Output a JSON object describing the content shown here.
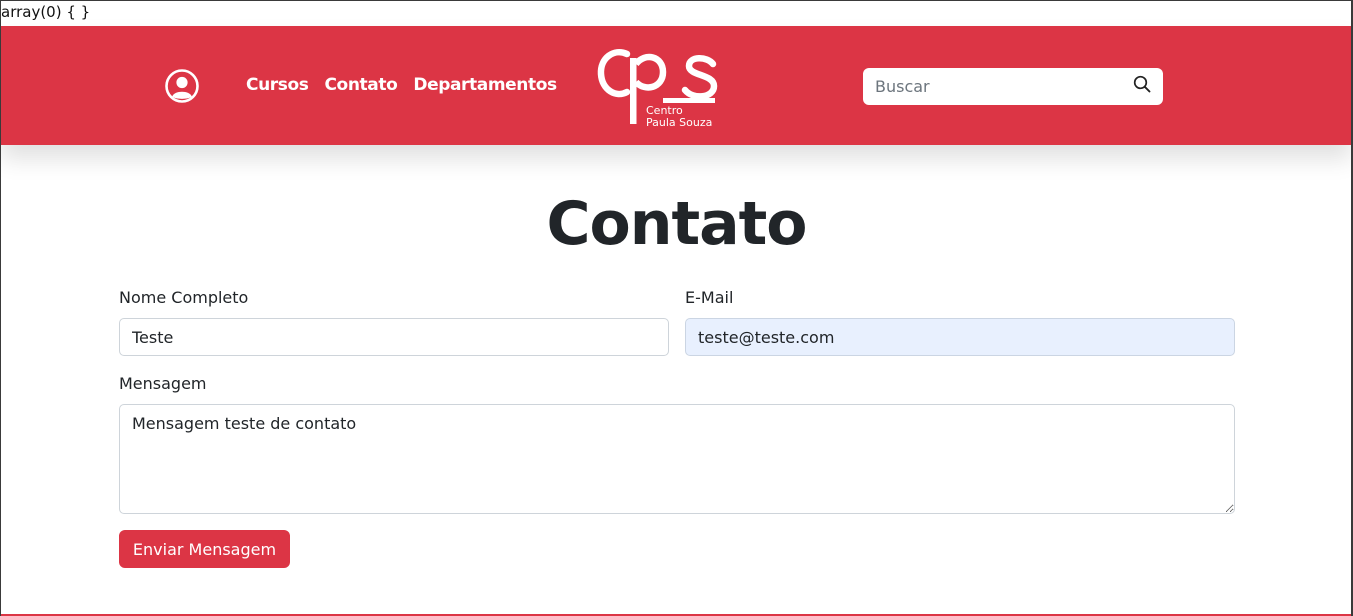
{
  "debug_output": "array(0) { }",
  "header": {
    "nav": [
      {
        "label": "Cursos"
      },
      {
        "label": "Contato"
      },
      {
        "label": "Departamentos"
      }
    ],
    "logo": {
      "mark": "CPS",
      "line1": "Centro",
      "line2": "Paula Souza"
    },
    "search": {
      "placeholder": "Buscar",
      "value": ""
    }
  },
  "page": {
    "title": "Contato"
  },
  "form": {
    "name_label": "Nome Completo",
    "name_value": "Teste",
    "email_label": "E-Mail",
    "email_value": "teste@teste.com",
    "message_label": "Mensagem",
    "message_value": "Mensagem teste de contato",
    "submit_label": "Enviar Mensagem"
  },
  "colors": {
    "brand": "#dc3545",
    "text": "#212529",
    "autofill_bg": "#e8f0fe"
  },
  "icons": [
    "user-circle-icon",
    "search-icon"
  ]
}
